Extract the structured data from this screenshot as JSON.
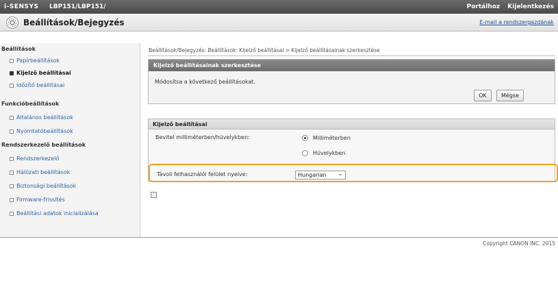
{
  "header": {
    "brand": "i-SENSYS",
    "model": "LBP151/LBP151/",
    "links": [
      "Portálhoz",
      "Kijelentkezés"
    ]
  },
  "titlebar": {
    "title": "Beállítások/Bejegyzés",
    "email_link": "E-mail a rendszergazdának"
  },
  "sidebar": {
    "sections": [
      {
        "heading": "Beállítások",
        "items": [
          {
            "label": "Papírbeállítások",
            "active": false
          },
          {
            "label": "Kijelző beállításai",
            "active": true
          },
          {
            "label": "Időzítő beállításai",
            "active": false
          }
        ]
      },
      {
        "heading": "Funkcióbeállítások",
        "items": [
          {
            "label": "Általános beállítások",
            "active": false
          },
          {
            "label": "Nyomtatóbeállítások",
            "active": false
          }
        ]
      },
      {
        "heading": "Rendszerkezelő beállítások",
        "items": [
          {
            "label": "Rendszerkezelő",
            "active": false
          },
          {
            "label": "Hálózati beállítások",
            "active": false
          },
          {
            "label": "Biztonsági beállítások",
            "active": false
          },
          {
            "label": "Firmware-frissítés",
            "active": false
          },
          {
            "label": "Beállítási adatok inicializálása",
            "active": false
          }
        ]
      }
    ]
  },
  "main": {
    "breadcrumb": "Beállítások/Bejegyzés: Beállítások: Kijelző beállításai > Kijelző beállításainak szerkesztése",
    "edit_panel": {
      "title": "Kijelző beállításainak szerkesztése",
      "message": "Módosítsa a következő beállításokat.",
      "ok_label": "OK",
      "cancel_label": "Mégse"
    },
    "settings_panel": {
      "title": "Kijelző beállításai",
      "unit_label": "Bevitel milliméterben/hüvelykben:",
      "unit_options": [
        {
          "label": "Milliméterben",
          "selected": true
        },
        {
          "label": "Hüvelykben",
          "selected": false
        }
      ],
      "language_label": "Távoli felhasználói felület nyelve:",
      "language_value": "Hungarian"
    }
  },
  "footer": {
    "copyright": "Copyright CANON INC. 2015"
  }
}
